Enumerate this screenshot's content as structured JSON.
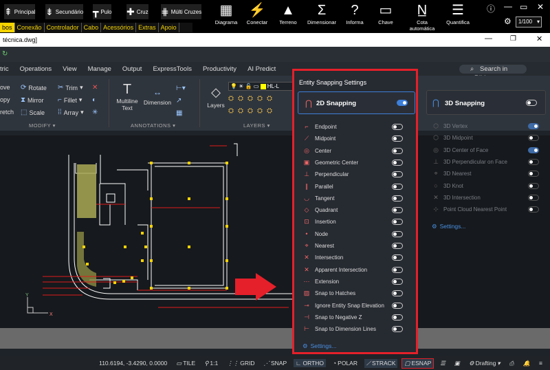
{
  "top_bar": {
    "quick_tools": [
      {
        "icon": "principal-icon",
        "label": "Principal"
      },
      {
        "icon": "secundario-icon",
        "label": "Secundário"
      },
      {
        "icon": "pulo-icon",
        "label": "Pulo"
      },
      {
        "icon": "cruz-icon",
        "label": "Cruz"
      },
      {
        "icon": "multi-cruzes-icon",
        "label": "Múlti Cruzes"
      }
    ],
    "tools": [
      {
        "icon": "diagrama-icon",
        "label": "Diagrama"
      },
      {
        "icon": "conectar-icon",
        "label": "Conectar"
      },
      {
        "icon": "terreno-icon",
        "label": "Terreno"
      },
      {
        "icon": "dimensionar-icon",
        "label": "Dimensionar"
      },
      {
        "icon": "informa-icon",
        "label": "Informa"
      },
      {
        "icon": "chave-icon",
        "label": "Chave"
      },
      {
        "icon": "cota-automatica-icon",
        "label": "Cota automática"
      },
      {
        "icon": "quantifica-icon",
        "label": "Quantifica"
      }
    ],
    "scale_value": "1/100",
    "tabs": [
      "bos",
      "Conexão",
      "Controlador",
      "Cabo",
      "Acessórios",
      "Extras",
      "Apoio"
    ]
  },
  "window": {
    "title": "técnica.dwg]"
  },
  "ribbon": {
    "tabs": [
      "tric",
      "Operations",
      "View",
      "Manage",
      "Output",
      "ExpressTools",
      "Productivity",
      "AI Predict"
    ],
    "search_placeholder": "Search in Ribbon",
    "modify_items": [
      "ove",
      "Rotate",
      "Trim",
      "opy",
      "Mirror",
      "Fillet",
      "retch",
      "Scale",
      "Array"
    ],
    "annotation_items": [
      "Multiline Text",
      "Dimension"
    ],
    "layers_items": [
      "Layers",
      "HL-L"
    ],
    "panel_labels": [
      "MODIFY",
      "ANNOTATIONS",
      "LAYERS"
    ]
  },
  "snap_panel": {
    "title": "Entity Snapping Settings",
    "snapping_2d": {
      "label": "2D Snapping",
      "enabled": true
    },
    "items_2d": [
      {
        "label": "Endpoint",
        "icon": "endpoint-icon",
        "on": false
      },
      {
        "label": "Midpoint",
        "icon": "midpoint-icon",
        "on": false
      },
      {
        "label": "Center",
        "icon": "center-icon",
        "on": false
      },
      {
        "label": "Geometric Center",
        "icon": "geometric-center-icon",
        "on": false
      },
      {
        "label": "Perpendicular",
        "icon": "perpendicular-icon",
        "on": false
      },
      {
        "label": "Parallel",
        "icon": "parallel-icon",
        "on": false
      },
      {
        "label": "Tangent",
        "icon": "tangent-icon",
        "on": false
      },
      {
        "label": "Quadrant",
        "icon": "quadrant-icon",
        "on": false
      },
      {
        "label": "Insertion",
        "icon": "insertion-icon",
        "on": false
      },
      {
        "label": "Node",
        "icon": "node-icon",
        "on": false
      },
      {
        "label": "Nearest",
        "icon": "nearest-icon",
        "on": false
      },
      {
        "label": "Intersection",
        "icon": "intersection-icon",
        "on": false
      },
      {
        "label": "Apparent Intersection",
        "icon": "apparent-intersection-icon",
        "on": false
      },
      {
        "label": "Extension",
        "icon": "extension-icon",
        "on": false
      },
      {
        "label": "Snap to Hatches",
        "icon": "hatches-icon",
        "on": false
      },
      {
        "label": "Ignore Entity Snap Elevation",
        "icon": "elevation-icon",
        "on": false
      },
      {
        "label": "Snap to Negative Z",
        "icon": "negative-z-icon",
        "on": false
      },
      {
        "label": "Snap to Dimension Lines",
        "icon": "dimension-lines-icon",
        "on": false
      }
    ],
    "settings_label": "Settings...",
    "snapping_3d": {
      "label": "3D Snapping",
      "enabled": false
    },
    "items_3d": [
      {
        "label": "3D Vertex",
        "on": true
      },
      {
        "label": "3D Midpoint",
        "on": false
      },
      {
        "label": "3D Center of Face",
        "on": true
      },
      {
        "label": "3D Perpendicular on Face",
        "on": false
      },
      {
        "label": "3D Nearest",
        "on": false
      },
      {
        "label": "3D Knot",
        "on": false
      },
      {
        "label": "3D Intersection",
        "on": false
      },
      {
        "label": "Point Cloud Nearest Point",
        "on": false
      }
    ],
    "settings_3d_label": "Settings..."
  },
  "status_bar": {
    "coordinates": "110.6194, -3.4290, 0.0000",
    "items": [
      "TILE",
      "1:1",
      "GRID",
      "SNAP",
      "ORTHO",
      "POLAR",
      "STRACK",
      "ESNAP"
    ],
    "workspace": "Drafting"
  },
  "colors": {
    "highlight_red": "#e5202a",
    "accent_blue": "#3d7fd9",
    "tab_yellow": "#f5d400"
  }
}
